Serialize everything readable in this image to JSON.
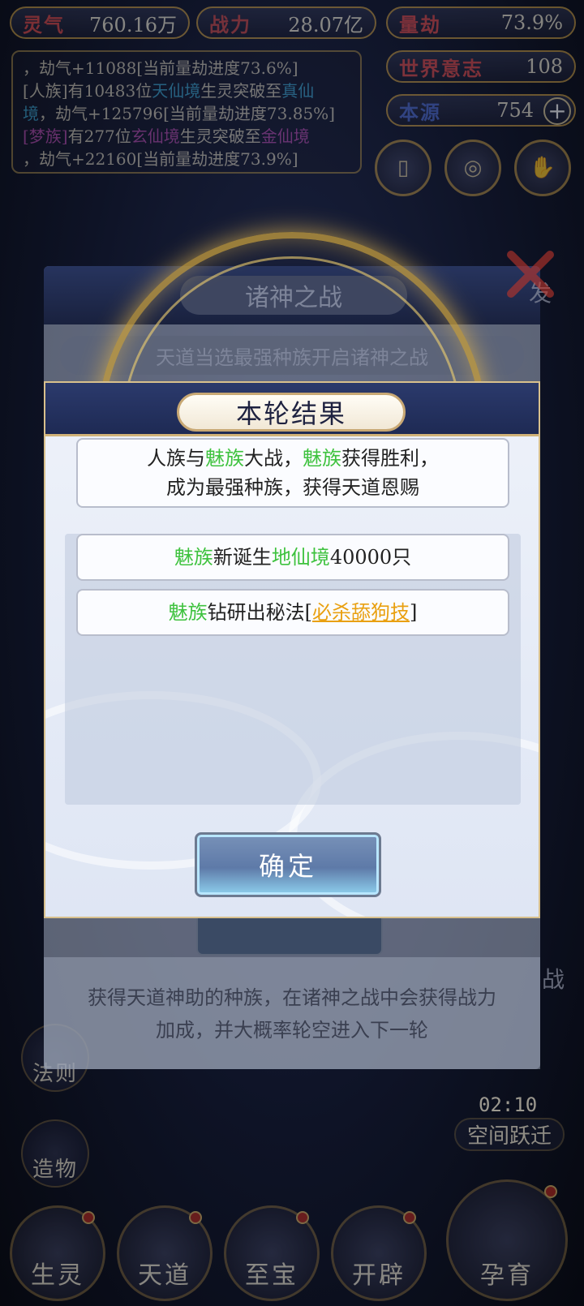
{
  "stats": {
    "lingqi": {
      "label": "灵气",
      "value": "760.16万"
    },
    "zhanli": {
      "label": "战力",
      "value": "28.07亿"
    },
    "liangjie": {
      "label": "量劫",
      "value": "73.9%"
    },
    "shijie": {
      "label": "世界意志",
      "value": "108"
    },
    "benyuan": {
      "label": "本源",
      "value": "754"
    }
  },
  "log": {
    "line1": "，劫气+11088[当前量劫进度73.6%]",
    "line2_a": "[人族]有10483位",
    "line2_b": "天仙境",
    "line2_c": "生灵突破至",
    "line2_d": "真仙",
    "line3_a": "境",
    "line3_b": "，劫气+125796[当前量劫进度73.85%]",
    "line4_a": "[梦族]",
    "line4_b": "有277位",
    "line4_c": "玄仙境",
    "line4_d": "生灵突破至",
    "line4_e": "金仙境",
    "line5": "，劫气+22160[当前量劫进度73.9%]"
  },
  "under_dialog": {
    "title": "诸神之战",
    "subtitle": "天道当选最强种族开启诸神之战",
    "description_1": "获得天道神助的种族，在诸神之战中会获得战力",
    "description_2": "加成，并大概率轮空进入下一轮",
    "side_right_1": "发",
    "side_right_2": "战"
  },
  "result_dialog": {
    "title": "本轮结果",
    "summary_1a": "人族与",
    "summary_1b": "魅族",
    "summary_1c": "大战，",
    "summary_1d": "魅族",
    "summary_1e": "获得胜利，",
    "summary_2": "成为最强种族，获得天道恩赐",
    "reward1_a": "魅族",
    "reward1_b": "新诞生",
    "reward1_c": "地仙境",
    "reward1_d": "40000只",
    "reward2_a": "魅族",
    "reward2_b": "钻研出秘法[",
    "reward2_c": "必杀舔狗技",
    "reward2_d": "]",
    "confirm": "确定"
  },
  "side_menu": {
    "fa_ze": "法则",
    "zao_wu": "造物",
    "timer": "02:10",
    "space_jump": "空间跃迁"
  },
  "bottom_nav": [
    {
      "label": "生灵"
    },
    {
      "label": "天道"
    },
    {
      "label": "至宝"
    },
    {
      "label": "开辟"
    },
    {
      "label": "孕育"
    }
  ],
  "colors": {
    "gold": "#c79f3e",
    "navy": "#1e2a54",
    "green": "#3ec23e",
    "orange": "#e9a010"
  }
}
